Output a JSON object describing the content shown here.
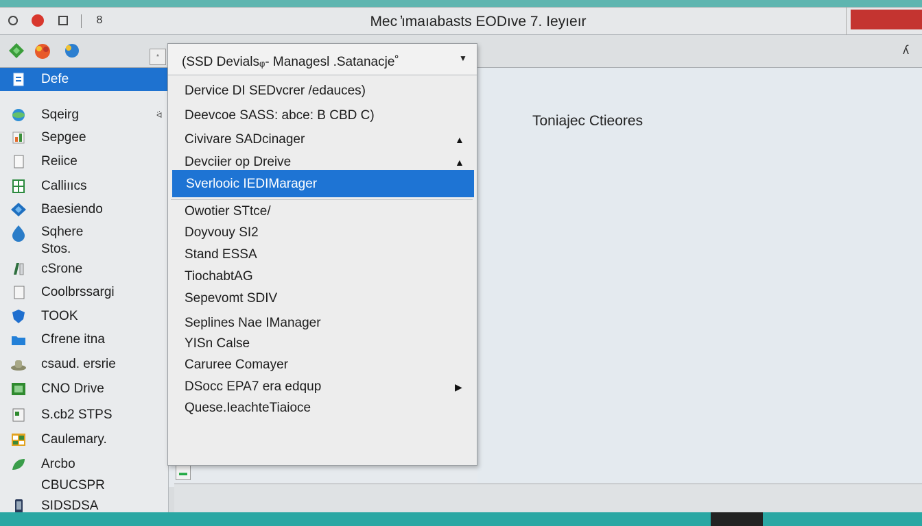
{
  "window": {
    "title": "Mec ̓ımaıabasts EODıve 7. Ieyıeır",
    "tb_extra": "8"
  },
  "toolbar": {
    "small_label": "*",
    "right_label": "ʎ"
  },
  "sidebar": {
    "items": [
      {
        "label": "Defe",
        "icon": "document-icon",
        "active": true
      },
      {
        "label": "Sqeirg",
        "icon": "globe-icon"
      },
      {
        "label": "Sepgee",
        "icon": "chart-icon"
      },
      {
        "label": "Reiice",
        "icon": "doc-outline-icon"
      },
      {
        "label": "Calliııcs",
        "icon": "grid-icon"
      },
      {
        "label": "Baesiendo",
        "icon": "diamond-icon"
      },
      {
        "label": "Sqhere",
        "icon": "drop-icon"
      },
      {
        "label": "Stos.",
        "icon": ""
      },
      {
        "label": "cSrone",
        "icon": "book-icon"
      },
      {
        "label": "Coolbrssargi",
        "icon": "file-icon"
      },
      {
        "label": "TOOK",
        "icon": "shield-icon"
      },
      {
        "label": "Cfrene itna",
        "icon": "folder-icon"
      },
      {
        "label": "csaud. ersrie",
        "icon": "hat-icon"
      },
      {
        "label": "CNO Drive",
        "icon": "drive-icon"
      },
      {
        "label": "S.cb2 STPS",
        "icon": "page-icon"
      },
      {
        "label": "Caulemary.",
        "icon": "calendar-icon"
      },
      {
        "label": "Arcbo",
        "icon": "leaf-icon"
      },
      {
        "label": "CBUCSPR",
        "icon": ""
      },
      {
        "label": "SIDSDSA",
        "icon": "phone-icon"
      }
    ],
    "arrow": "ᐛ"
  },
  "dropdown": {
    "header": "(SSD Devialsᵩ- Managesl .Satanacje˚",
    "chevron": "▼",
    "items": [
      {
        "label": "Dervice DI SEDvcrer /edauces)"
      },
      {
        "label": "Deevcoe SASS: abce: B CBD C)"
      },
      {
        "label": "Civivare SADcinager",
        "mark": "▲"
      },
      {
        "label": "Devciier op Dreive",
        "mark": "▲"
      },
      {
        "label": "Sverlooic IEDIMarager",
        "selected": true
      },
      {
        "label": "Owotier STtce/"
      },
      {
        "label": "Doyvouy SI2"
      },
      {
        "label": "Stand ESSA"
      },
      {
        "label": "TiochabtAG"
      },
      {
        "label": "Sepevomt SDIV"
      },
      {
        "label": "Seplines Nae IManager"
      },
      {
        "label": "YISn Calse"
      },
      {
        "label": "Caruree Comayer"
      },
      {
        "label": "DSocc EPA7 era edqup",
        "mark": "▶"
      },
      {
        "label": "Quese.IeachteTiaioce"
      }
    ]
  },
  "content": {
    "heading": "Toniajec Ctieores"
  },
  "colors": {
    "accent": "#1e72d0",
    "close_red": "#d8372d"
  }
}
